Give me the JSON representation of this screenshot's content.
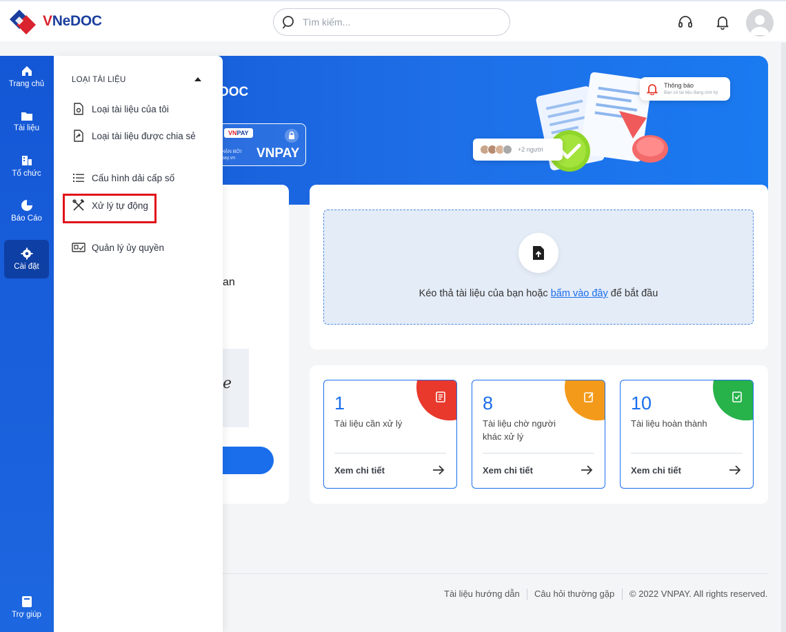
{
  "header": {
    "brand": {
      "accent": "V",
      "rest": "NeDOC"
    },
    "search_placeholder": "Tìm kiếm...",
    "icons": [
      "headset-icon",
      "bell-icon",
      "user-avatar"
    ]
  },
  "rail": {
    "items": [
      {
        "label": "Trang chủ",
        "icon": "home-icon"
      },
      {
        "label": "Tài liệu",
        "icon": "folder-icon"
      },
      {
        "label": "Tổ chức",
        "icon": "building-icon"
      },
      {
        "label": "Báo Cáo",
        "icon": "pie-chart-icon"
      },
      {
        "label": "Cài đặt",
        "icon": "gear-icon",
        "active": true
      }
    ],
    "help": {
      "label": "Trợ giúp",
      "icon": "book-icon"
    }
  },
  "panel": {
    "title": "LOẠI TÀI LIỆU",
    "items": [
      {
        "label": "Loại tài liệu của tôi",
        "icon": "doc-settings-icon"
      },
      {
        "label": "Loại tài liệu được chia sẻ",
        "icon": "share-doc-icon"
      },
      {
        "label": "Cấu hình dải cấp số",
        "icon": "list-icon"
      },
      {
        "label": "Xử lý tự động",
        "icon": "tools-icon",
        "highlighted": true
      },
      {
        "label": "Quản lý ủy quyền",
        "icon": "id-card-icon"
      }
    ]
  },
  "banner": {
    "title_fragment": "DOC",
    "badge_vnpay_a": "VN",
    "badge_vnpay_b": "PAY",
    "badge_small": "HẬN BỞI\npay.vn",
    "badge_big": "VNPAY",
    "people_more": "+2 người",
    "notif_title": "Thông báo",
    "notif_text": "Bạn có tài liệu đang chờ ký"
  },
  "left_card": {
    "fragment": "an",
    "signature_fragment": "e"
  },
  "upload": {
    "text_before": "Kéo thả tài liệu của bạn hoặc ",
    "link": "bấm vào đây",
    "text_after": " để bắt đầu"
  },
  "stats": [
    {
      "value": "1",
      "label": "Tài liệu cần xử lý",
      "more": "Xem chi tiết",
      "color": "#e8392c"
    },
    {
      "value": "8",
      "label": "Tài liệu chờ người khác xử lý",
      "more": "Xem chi tiết",
      "color": "#f39a1b"
    },
    {
      "value": "10",
      "label": "Tài liệu hoàn thành",
      "more": "Xem chi tiết",
      "color": "#27b24a"
    }
  ],
  "footer": {
    "guide": "Tài liệu hướng dẫn",
    "faq": "Câu hỏi thường gặp",
    "copyright": "© 2022 VNPAY. All rights reserved."
  },
  "colors": {
    "primary": "#1a6eec",
    "highlight": "#e0101a"
  }
}
